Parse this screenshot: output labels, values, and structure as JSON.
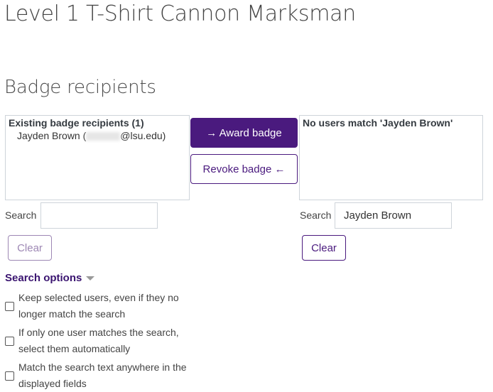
{
  "page": {
    "title": "Level 1 T-Shirt Cannon Marksman",
    "section_title": "Badge recipients"
  },
  "existing": {
    "group_label": "Existing badge recipients (1)",
    "users": [
      {
        "name_prefix": "Jayden Brown (",
        "email_suffix": "@lsu.edu)"
      }
    ],
    "search_label": "Search",
    "search_value": "",
    "clear_label": "Clear"
  },
  "actions": {
    "award_label": "→ Award badge",
    "revoke_label": "Revoke badge ←",
    "primary_color": "#4a1a7e"
  },
  "potential": {
    "group_label": "No users match 'Jayden Brown'",
    "search_label": "Search",
    "search_value": "Jayden Brown",
    "clear_label": "Clear"
  },
  "search_options": {
    "toggle_label": "Search options",
    "options": [
      {
        "label": "Keep selected users, even if they no longer match the search",
        "checked": false
      },
      {
        "label": "If only one user matches the search, select them automatically",
        "checked": false
      },
      {
        "label": "Match the search text anywhere in the displayed fields",
        "checked": false
      }
    ]
  }
}
